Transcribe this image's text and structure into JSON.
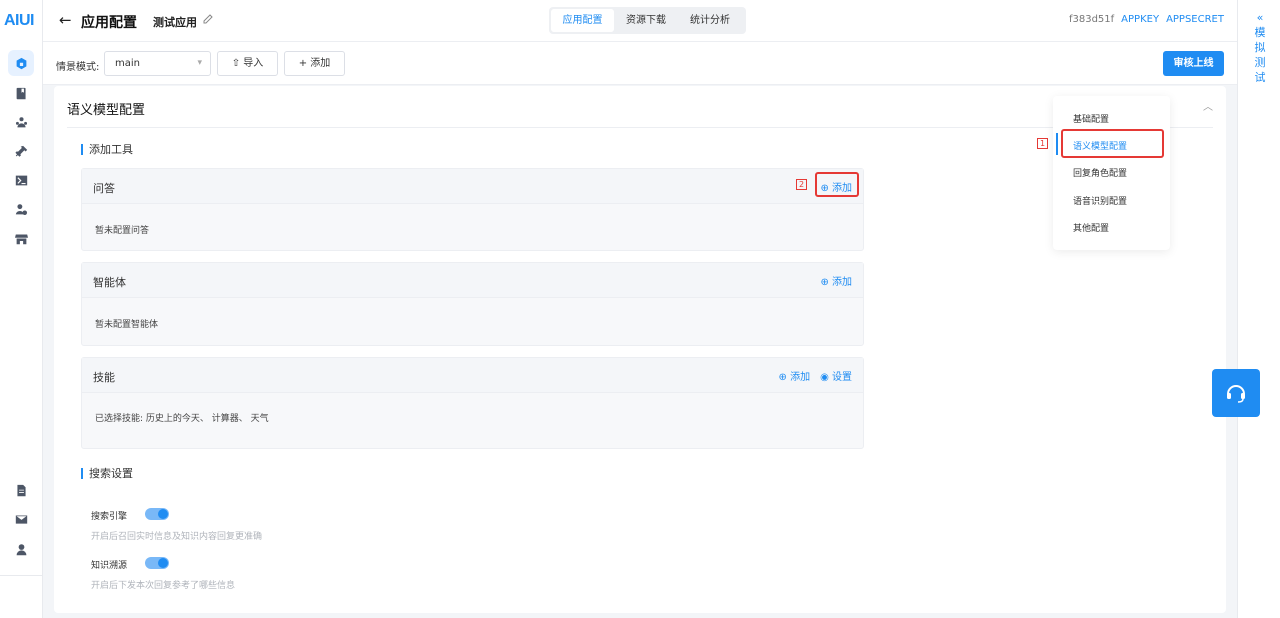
{
  "logo": "AIUI",
  "header": {
    "back_icon": "arrow-left-icon",
    "title": "应用配置",
    "app_name": "测试应用",
    "tabs": [
      "应用配置",
      "资源下载",
      "统计分析"
    ],
    "active_tab": "应用配置",
    "app_id": "f383d51f",
    "appkey": "APPKEY",
    "appsecret": "APPSECRET"
  },
  "right_strip": {
    "chevron": "«",
    "label": [
      "模",
      "拟",
      "测",
      "试"
    ]
  },
  "toolbar": {
    "scene_label": "情景模式:",
    "scene_value": "main",
    "import_label": "导入",
    "add_label": "添加",
    "submit_label": "审核上线"
  },
  "card": {
    "title": "语义模型配置",
    "tools_heading": "添加工具",
    "panels": [
      {
        "title": "问答",
        "actions": [
          "添加"
        ],
        "body": "暂未配置问答"
      },
      {
        "title": "智能体",
        "actions": [
          "添加"
        ],
        "body": "暂未配置智能体"
      },
      {
        "title": "技能",
        "actions": [
          "添加",
          "设置"
        ],
        "body": "已选择技能:  历史上的今天、 计算器、 天气"
      }
    ],
    "search_heading": "搜索设置",
    "switches": [
      {
        "label": "搜索引擎",
        "on": true,
        "hint": "开启后召回实时信息及知识内容回复更准确"
      },
      {
        "label": "知识溯源",
        "on": true,
        "hint": "开启后下发本次回复参考了哪些信息"
      }
    ]
  },
  "menu": {
    "items": [
      "基础配置",
      "语义模型配置",
      "回复角色配置",
      "语音识别配置",
      "其他配置"
    ],
    "active": "语义模型配置"
  },
  "annotations": {
    "marker_1": "1",
    "marker_2": "2"
  },
  "colors": {
    "accent": "#1f8cf2",
    "highlight": "#e53935"
  }
}
